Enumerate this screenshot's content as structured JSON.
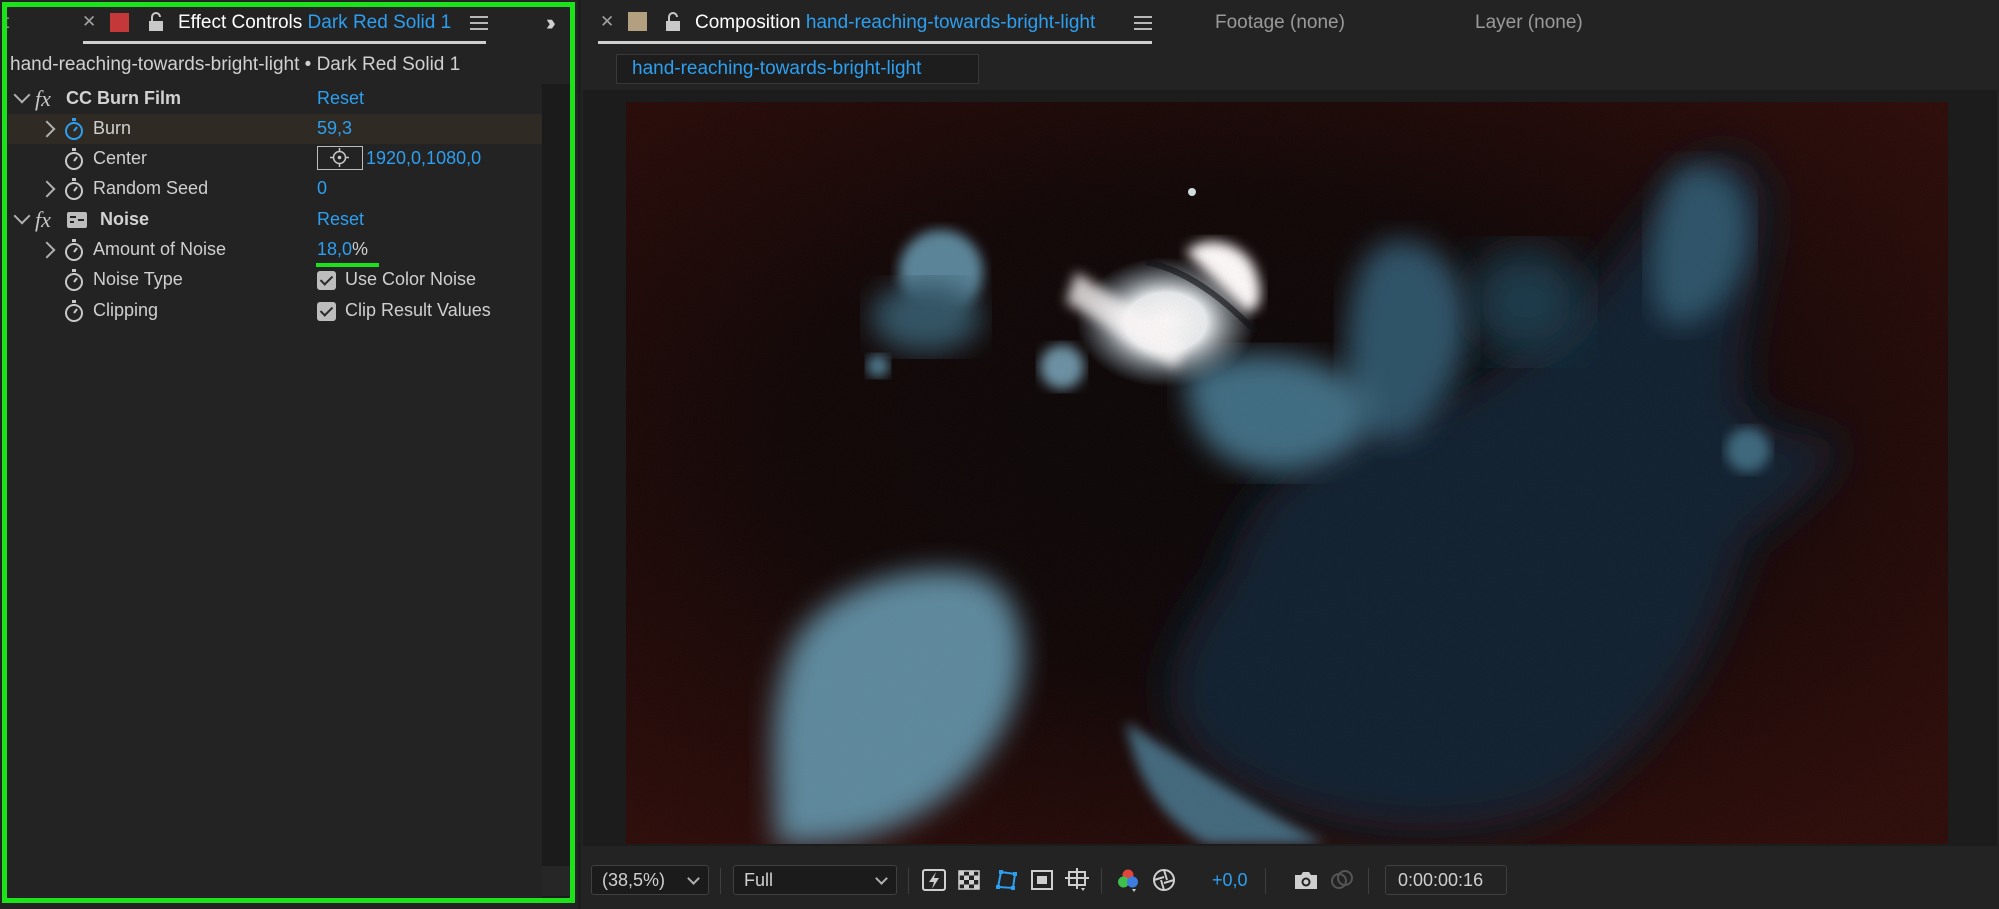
{
  "effect_panel": {
    "truncated_tab": "t",
    "tab_label": "Effect Controls",
    "tab_layer": "Dark Red Solid 1",
    "swatch_color": "#c4383a",
    "layer_path": "hand-reaching-towards-bright-light • Dark Red Solid 1",
    "effects": [
      {
        "name": "CC Burn Film",
        "reset": "Reset",
        "params": [
          {
            "name": "Burn",
            "value": "59,3"
          },
          {
            "name": "Center",
            "value": "1920,0,1080,0"
          },
          {
            "name": "Random Seed",
            "value": "0"
          }
        ]
      },
      {
        "name": "Noise",
        "reset": "Reset",
        "params": [
          {
            "name": "Amount of Noise",
            "value_number": "18,0",
            "value_unit": "%"
          },
          {
            "name": "Noise Type",
            "value": "Use Color Noise",
            "checked": true
          },
          {
            "name": "Clipping",
            "value": "Clip Result Values",
            "checked": true
          }
        ]
      }
    ]
  },
  "composition_panel": {
    "tab_label": "Composition",
    "tab_comp": "hand-reaching-towards-bright-light",
    "swatch_color": "#b3a080",
    "footage_tab": "Footage (none)",
    "layer_tab": "Layer (none)",
    "comp_subtab": "hand-reaching-towards-bright-light"
  },
  "viewer_controls": {
    "zoom": "(38,5%)",
    "resolution": "Full",
    "exposure": "+0,0",
    "timecode": "0:00:00:16"
  },
  "colors": {
    "accent_blue": "#2d9ff0",
    "highlight_green": "#1be21b"
  }
}
